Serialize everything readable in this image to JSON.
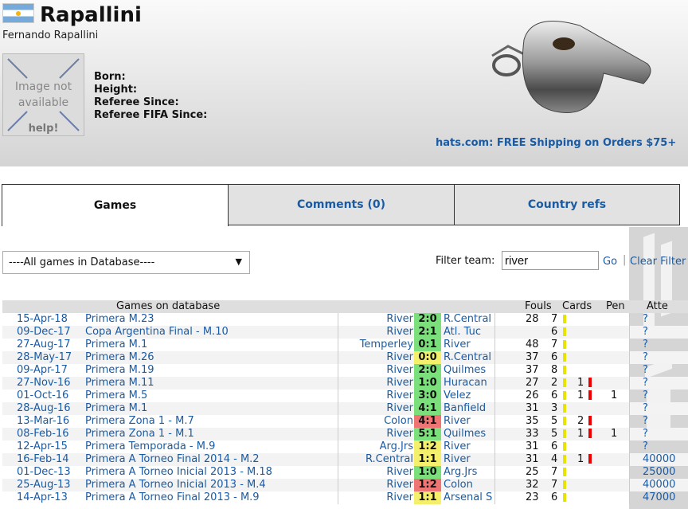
{
  "referee": {
    "short_name": "Rapallini",
    "full_name": "Fernando Rapallini",
    "photo_placeholder_line1": "Image not",
    "photo_placeholder_line2": "available",
    "photo_help": "help!",
    "born_label": "Born:",
    "height_label": "Height:",
    "since_label": "Referee Since:",
    "fifa_label": "Referee FIFA Since:"
  },
  "ad": {
    "text": "hats.com: FREE Shipping on Orders $75+"
  },
  "tabs": [
    {
      "label": "Games",
      "active": true
    },
    {
      "label": "Comments (0)",
      "active": false
    },
    {
      "label": "Country refs",
      "active": false
    }
  ],
  "filter": {
    "select_value": "----All games in Database----",
    "team_label": "Filter team:",
    "team_value": "river",
    "go_label": "Go",
    "separator": "|",
    "clear_label": "Clear Filter"
  },
  "table": {
    "headers": {
      "games": "Games on database",
      "fouls": "Fouls",
      "cards": "Cards",
      "pen": "Pen",
      "atte": "Atte"
    },
    "rows": [
      {
        "date": "15-Apr-18",
        "comp": "Primera M.23",
        "home": "River",
        "score": "2:0",
        "result": "home",
        "away": "R.Central",
        "fouls": "28",
        "yellow": "7",
        "red": "",
        "pen": "",
        "att": "?"
      },
      {
        "date": "09-Dec-17",
        "comp": "Copa Argentina Final - M.10",
        "home": "River",
        "score": "2:1",
        "result": "home",
        "away": "Atl. Tuc",
        "fouls": "",
        "yellow": "6",
        "red": "",
        "pen": "",
        "att": "?"
      },
      {
        "date": "27-Aug-17",
        "comp": "Primera M.1",
        "home": "Temperley",
        "score": "0:1",
        "result": "home",
        "away": "River",
        "fouls": "48",
        "yellow": "7",
        "red": "",
        "pen": "",
        "att": "?"
      },
      {
        "date": "28-May-17",
        "comp": "Primera M.26",
        "home": "River",
        "score": "0:0",
        "result": "draw",
        "away": "R.Central",
        "fouls": "37",
        "yellow": "6",
        "red": "",
        "pen": "",
        "att": "?"
      },
      {
        "date": "09-Apr-17",
        "comp": "Primera M.19",
        "home": "River",
        "score": "2:0",
        "result": "home",
        "away": "Quilmes",
        "fouls": "37",
        "yellow": "8",
        "red": "",
        "pen": "",
        "att": "?"
      },
      {
        "date": "27-Nov-16",
        "comp": "Primera M.11",
        "home": "River",
        "score": "1:0",
        "result": "home",
        "away": "Huracan",
        "fouls": "27",
        "yellow": "2",
        "red": "1",
        "pen": "",
        "att": "?"
      },
      {
        "date": "01-Oct-16",
        "comp": "Primera M.5",
        "home": "River",
        "score": "3:0",
        "result": "home",
        "away": "Velez",
        "fouls": "26",
        "yellow": "6",
        "red": "1",
        "pen": "1",
        "att": "?"
      },
      {
        "date": "28-Aug-16",
        "comp": "Primera M.1",
        "home": "River",
        "score": "4:1",
        "result": "home",
        "away": "Banfield",
        "fouls": "31",
        "yellow": "3",
        "red": "",
        "pen": "",
        "att": "?"
      },
      {
        "date": "13-Mar-16",
        "comp": "Primera Zona 1 - M.7",
        "home": "Colon",
        "score": "4:1",
        "result": "away",
        "away": "River",
        "fouls": "35",
        "yellow": "5",
        "red": "2",
        "pen": "",
        "att": "?"
      },
      {
        "date": "08-Feb-16",
        "comp": "Primera Zona 1 - M.1",
        "home": "River",
        "score": "5:1",
        "result": "home",
        "away": "Quilmes",
        "fouls": "33",
        "yellow": "5",
        "red": "1",
        "pen": "1",
        "att": "?"
      },
      {
        "date": "12-Apr-15",
        "comp": "Primera Temporada - M.9",
        "home": "Arg.Jrs",
        "score": "1:2",
        "result": "draw",
        "away": "River",
        "fouls": "31",
        "yellow": "6",
        "red": "",
        "pen": "",
        "att": "?"
      },
      {
        "date": "16-Feb-14",
        "comp": "Primera A Torneo Final 2014 - M.2",
        "home": "R.Central",
        "score": "1:1",
        "result": "draw",
        "away": "River",
        "fouls": "31",
        "yellow": "4",
        "red": "1",
        "pen": "",
        "att": "40000"
      },
      {
        "date": "01-Dec-13",
        "comp": "Primera A Torneo Inicial 2013 - M.18",
        "home": "River",
        "score": "1:0",
        "result": "home",
        "away": "Arg.Jrs",
        "fouls": "25",
        "yellow": "7",
        "red": "",
        "pen": "",
        "att": "25000"
      },
      {
        "date": "25-Aug-13",
        "comp": "Primera A Torneo Inicial 2013 - M.4",
        "home": "River",
        "score": "1:2",
        "result": "away",
        "away": "Colon",
        "fouls": "32",
        "yellow": "7",
        "red": "",
        "pen": "",
        "att": "40000"
      },
      {
        "date": "14-Apr-13",
        "comp": "Primera A Torneo Final 2013 - M.9",
        "home": "River",
        "score": "1:1",
        "result": "draw",
        "away": "Arsenal S",
        "fouls": "23",
        "yellow": "6",
        "red": "",
        "pen": "",
        "att": "47000"
      }
    ]
  },
  "colors": {
    "link": "#1a5ba3",
    "win": "#7be07b",
    "draw": "#f4f06c",
    "loss": "#ef7474"
  }
}
